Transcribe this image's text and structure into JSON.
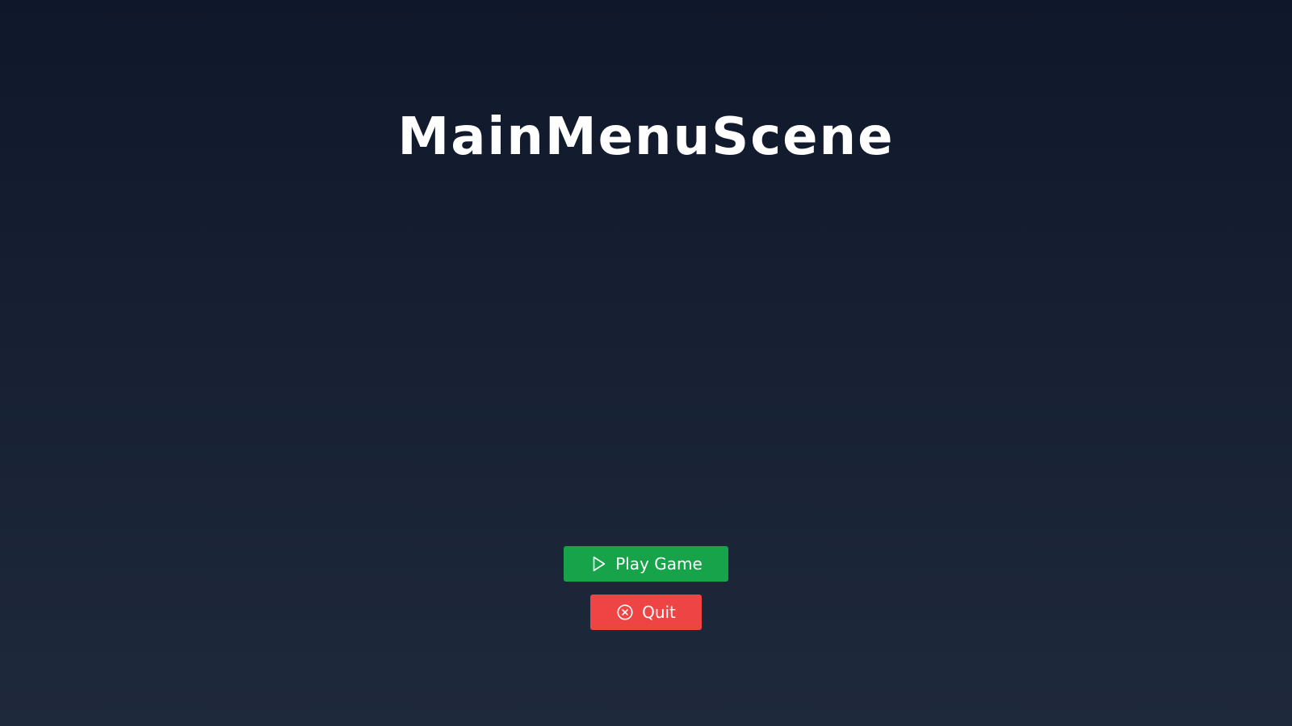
{
  "scene": {
    "title": "MainMenuScene"
  },
  "menu": {
    "play_button": {
      "label": "Play Game",
      "icon": "play-icon",
      "color": "#16a34a"
    },
    "quit_button": {
      "label": "Quit",
      "icon": "close-circle-icon",
      "color": "#ef4444"
    }
  },
  "colors": {
    "background_top": "#0f172a",
    "background_bottom": "#1e293b",
    "text": "#ffffff"
  }
}
